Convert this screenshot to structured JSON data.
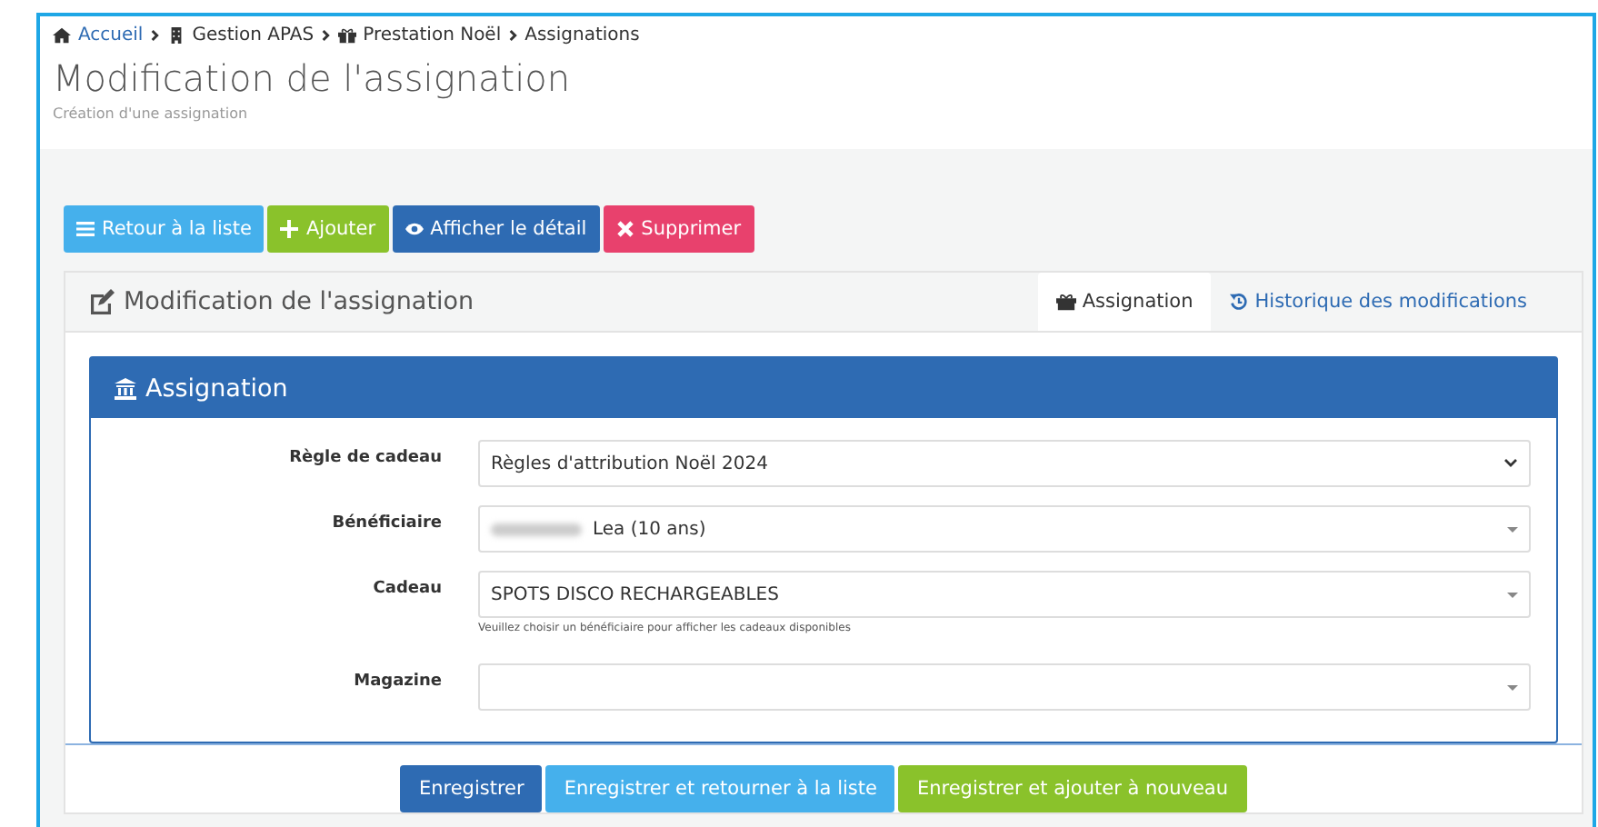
{
  "breadcrumb": [
    {
      "label": "Accueil"
    },
    {
      "label": "Gestion APAS"
    },
    {
      "label": "Prestation Noël"
    },
    {
      "label": "Assignations"
    }
  ],
  "page": {
    "title": "Modification de l'assignation",
    "subtitle": "Création d'une assignation"
  },
  "toolbar": [
    {
      "label": "Retour à la liste",
      "kind": "info"
    },
    {
      "label": "Ajouter",
      "kind": "success"
    },
    {
      "label": "Afficher le détail",
      "kind": "primary"
    },
    {
      "label": "Supprimer",
      "kind": "danger"
    }
  ],
  "panel": {
    "title": "Modification de l'assignation",
    "tabs": [
      {
        "label": "Assignation",
        "selected": true
      },
      {
        "label": "Historique des modifications",
        "selected": false
      }
    ]
  },
  "form": {
    "title": "Assignation",
    "fields": [
      {
        "label": "Règle de cadeau",
        "value": "Règles d'attribution Noël 2024",
        "kind": "select"
      },
      {
        "label": "Bénéficiaire",
        "value": "Lea (10 ans)",
        "kind": "combo",
        "redacted": true
      },
      {
        "label": "Cadeau",
        "value": "SPOTS DISCO RECHARGEABLES",
        "kind": "combo",
        "help": "Veuillez choisir un bénéficiaire pour afficher les cadeaux disponibles"
      },
      {
        "label": "Magazine",
        "kind": "combo"
      }
    ]
  },
  "actions": [
    {
      "label": "Enregistrer",
      "kind": "primary"
    },
    {
      "label": "Enregistrer et retourner à la liste",
      "kind": "info"
    },
    {
      "label": "Enregistrer et ajouter à nouveau",
      "kind": "success"
    }
  ]
}
